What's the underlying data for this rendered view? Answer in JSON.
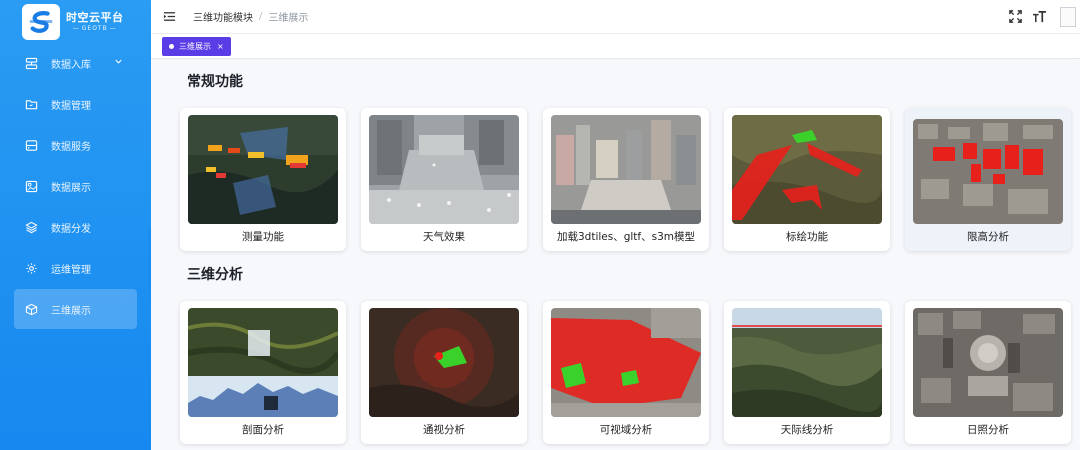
{
  "brand": {
    "title": "时空云平台",
    "subtitle": "GEOTB"
  },
  "sidebar": {
    "items": [
      {
        "label": "数据入库",
        "icon": "database-input-icon",
        "expandable": true
      },
      {
        "label": "数据管理",
        "icon": "folder-icon"
      },
      {
        "label": "数据服务",
        "icon": "server-icon"
      },
      {
        "label": "数据展示",
        "icon": "display-icon"
      },
      {
        "label": "数据分发",
        "icon": "layers-icon"
      },
      {
        "label": "运维管理",
        "icon": "gear-icon"
      },
      {
        "label": "三维展示",
        "icon": "cube-icon",
        "active": true
      }
    ],
    "collapse_glyph": "‹"
  },
  "header": {
    "breadcrumb": [
      "三维功能模块",
      "三维展示"
    ],
    "breadcrumb_sep": "/"
  },
  "tabs": [
    {
      "label": "三维展示",
      "close": "×",
      "active": true
    }
  ],
  "sections": [
    {
      "title": "常规功能",
      "cards": [
        {
          "label": "测量功能",
          "thumb": "measure"
        },
        {
          "label": "天气效果",
          "thumb": "weather"
        },
        {
          "label": "加载3dtiles、gltf、s3m模型",
          "thumb": "models"
        },
        {
          "label": "标绘功能",
          "thumb": "plot"
        },
        {
          "label": "限高分析",
          "thumb": "height-limit",
          "highlighted": true
        }
      ]
    },
    {
      "title": "三维分析",
      "cards": [
        {
          "label": "剖面分析",
          "thumb": "profile"
        },
        {
          "label": "通视分析",
          "thumb": "sightline"
        },
        {
          "label": "可视域分析",
          "thumb": "viewshed"
        },
        {
          "label": "天际线分析",
          "thumb": "skyline"
        },
        {
          "label": "日照分析",
          "thumb": "sunlight"
        }
      ]
    }
  ],
  "colors": {
    "sidebar": "#1a8df0",
    "tab_active": "#5b3de8",
    "highlight_red": "#e8201c"
  }
}
